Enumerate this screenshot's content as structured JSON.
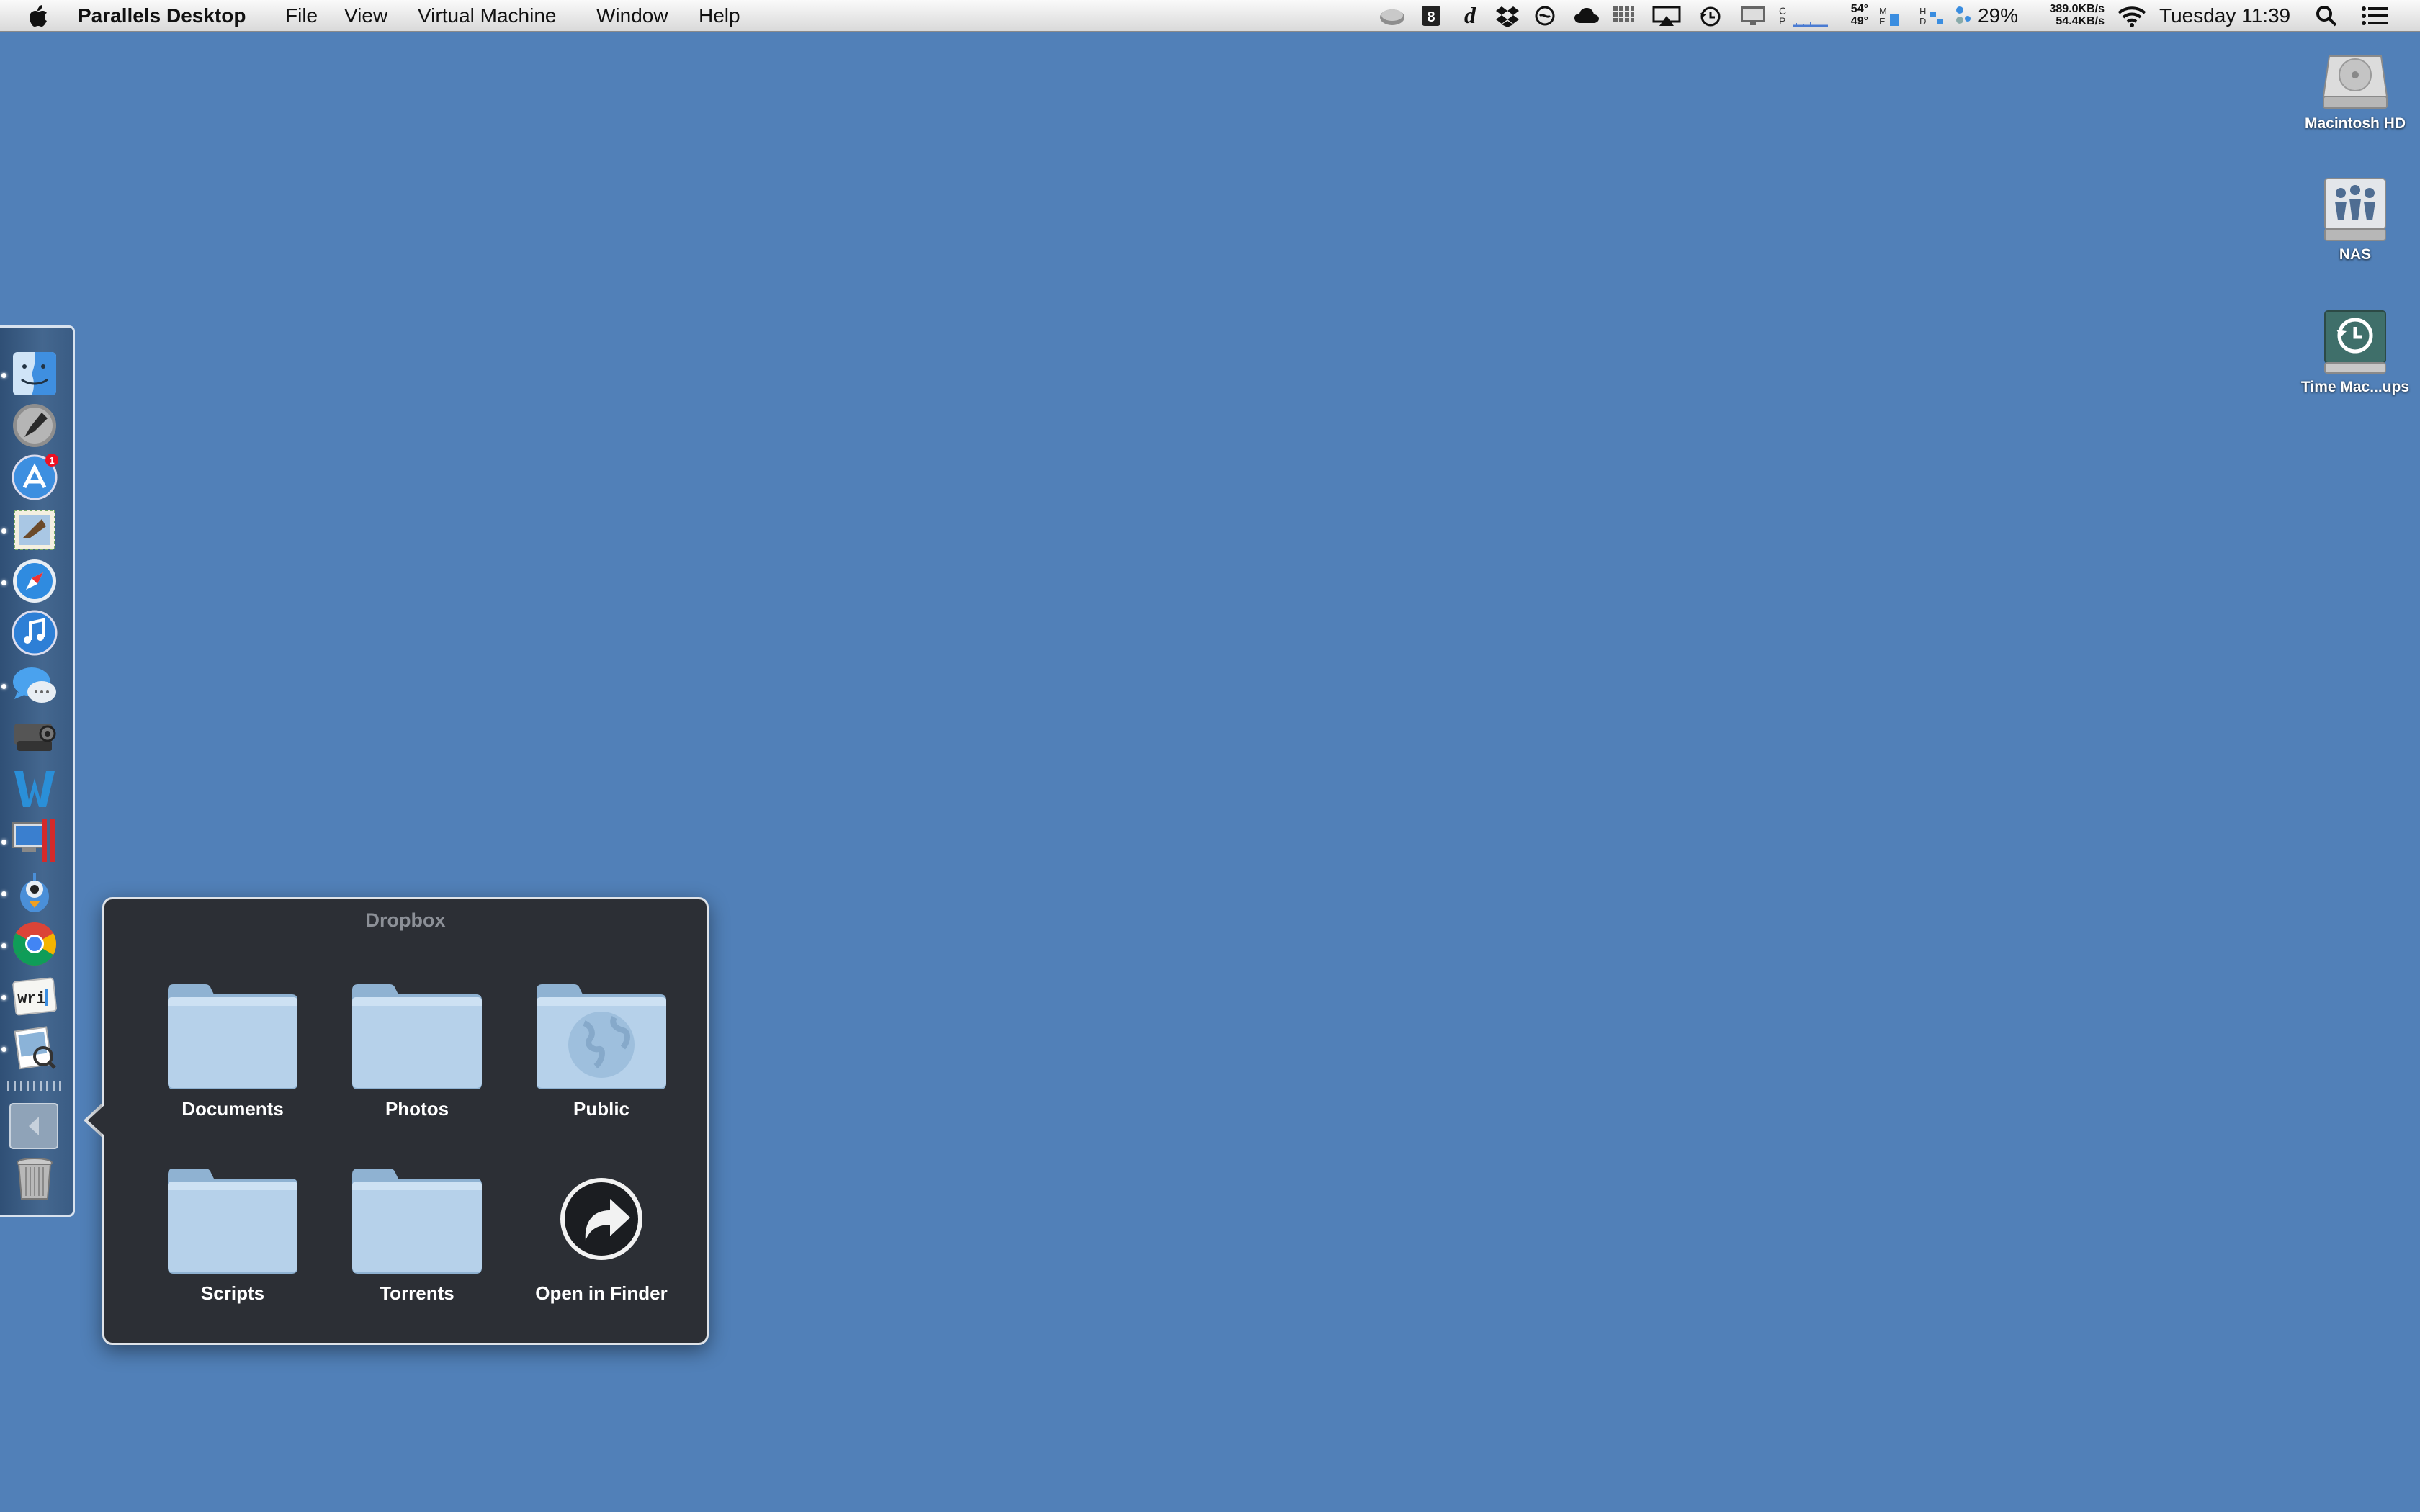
{
  "menubar": {
    "app_name": "Parallels Desktop",
    "menus": [
      "File",
      "View",
      "Virtual Machine",
      "Window",
      "Help"
    ],
    "status": {
      "temp_high": "54°",
      "temp_low": "49°",
      "battery": "29%",
      "net_up": "389.0KB/s",
      "net_down": "54.4KB/s",
      "clock": "Tuesday 11:39"
    },
    "status_icons": [
      "drive-icon",
      "script-icon",
      "dictionary-icon",
      "dropbox-icon",
      "sync-icon",
      "cloud-icon",
      "grid-icon",
      "airplay-icon",
      "time-machine-icon",
      "display-icon",
      "cpu-graph-icon",
      "memory-icon",
      "disk-icon",
      "battery-icon",
      "wifi-icon",
      "search-icon",
      "notification-list-icon"
    ]
  },
  "desktop": {
    "icons": [
      {
        "label": "Macintosh HD",
        "icon": "hard-drive-icon"
      },
      {
        "label": "NAS",
        "icon": "network-share-icon"
      },
      {
        "label": "Time Mac...ups",
        "icon": "time-machine-drive-icon"
      }
    ]
  },
  "dock": {
    "apps": [
      {
        "name": "Finder",
        "icon": "finder-icon",
        "running": true
      },
      {
        "name": "Launchpad",
        "icon": "launchpad-icon",
        "running": false
      },
      {
        "name": "App Store",
        "icon": "app-store-icon",
        "running": false,
        "badge": "1"
      },
      {
        "name": "Mail",
        "icon": "mail-icon",
        "running": true
      },
      {
        "name": "Safari",
        "icon": "safari-icon",
        "running": true
      },
      {
        "name": "iTunes",
        "icon": "itunes-icon",
        "running": false
      },
      {
        "name": "Messages",
        "icon": "messages-icon",
        "running": true
      },
      {
        "name": "Steam",
        "icon": "steam-icon",
        "running": false
      },
      {
        "name": "Word",
        "icon": "word-icon",
        "running": false
      },
      {
        "name": "Parallels Desktop",
        "icon": "parallels-icon",
        "running": true
      },
      {
        "name": "Tweetbot",
        "icon": "tweetbot-icon",
        "running": true
      },
      {
        "name": "Chrome",
        "icon": "chrome-icon",
        "running": true
      },
      {
        "name": "Writer",
        "icon": "writer-icon",
        "running": true
      },
      {
        "name": "Preview",
        "icon": "preview-icon",
        "running": true
      }
    ],
    "stack_icon": "stack-arrow-icon",
    "trash_icon": "trash-icon"
  },
  "popup": {
    "title": "Dropbox",
    "items": [
      {
        "label": "Documents",
        "icon": "folder-icon"
      },
      {
        "label": "Photos",
        "icon": "folder-icon"
      },
      {
        "label": "Public",
        "icon": "public-folder-icon"
      },
      {
        "label": "Scripts",
        "icon": "folder-icon"
      },
      {
        "label": "Torrents",
        "icon": "folder-icon"
      },
      {
        "label": "Open in Finder",
        "icon": "open-in-finder-icon"
      }
    ]
  }
}
